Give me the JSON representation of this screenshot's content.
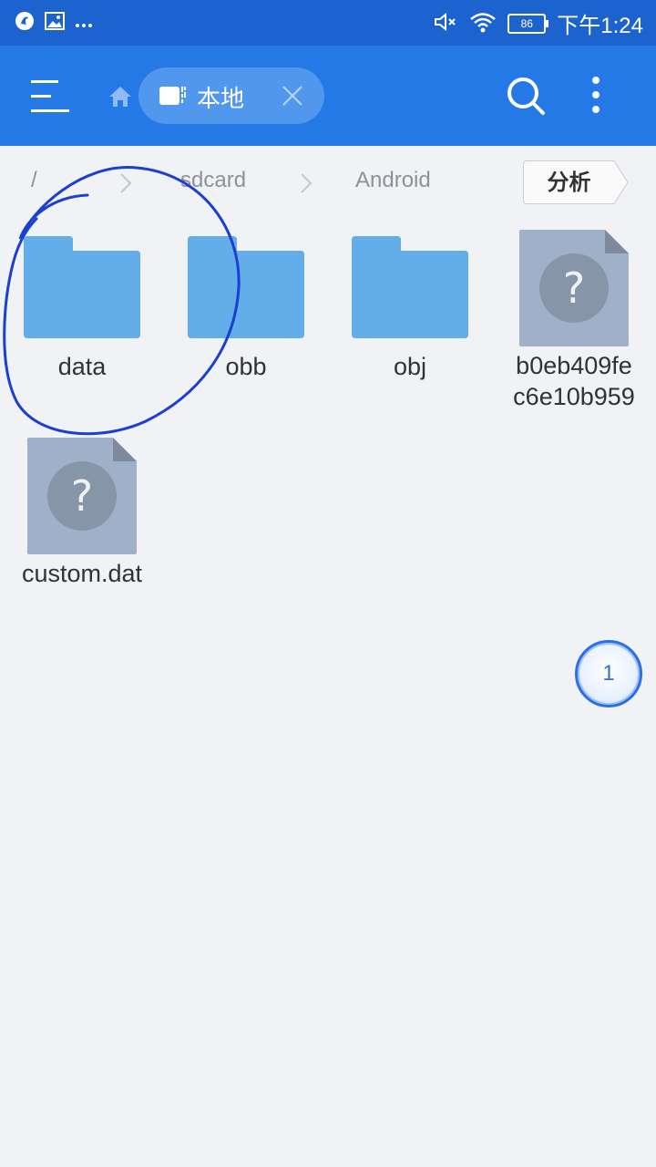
{
  "status_bar": {
    "time": "下午1:24",
    "battery": "86"
  },
  "app_bar": {
    "location_chip_label": "本地"
  },
  "breadcrumb": {
    "root": "/",
    "items": [
      "sdcard",
      "Android"
    ],
    "analyze_label": "分析"
  },
  "files": [
    {
      "name": "data",
      "type": "folder"
    },
    {
      "name": "obb",
      "type": "folder"
    },
    {
      "name": "obj",
      "type": "folder"
    },
    {
      "name_line1": "b0eb409fe",
      "name_line2": "c6e10b959",
      "type": "unknown"
    },
    {
      "name": "custom.dat",
      "type": "unknown"
    }
  ],
  "floating_badge": "1",
  "colors": {
    "status_bar": "#1d63cf",
    "app_bar": "#2579e6",
    "folder": "#63ade8",
    "unknown_file": "#9fb0c8",
    "annotation_ink": "#1b3fd0"
  }
}
